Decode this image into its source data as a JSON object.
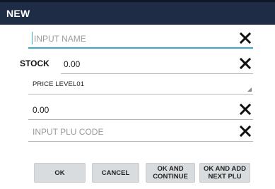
{
  "dialog": {
    "title": "NEW"
  },
  "fields": {
    "name": {
      "placeholder": "INPUT NAME",
      "value": ""
    },
    "stock": {
      "label": "STOCK",
      "value": "0.00"
    },
    "price_level": {
      "selected": "PRICE LEVEL01"
    },
    "price": {
      "value": "0.00"
    },
    "plu": {
      "placeholder": "INPUT PLU CODE",
      "value": ""
    }
  },
  "buttons": {
    "ok": "OK",
    "cancel": "CANCEL",
    "ok_continue": [
      "OK AND",
      "CONTINUE"
    ],
    "ok_add_next": [
      "OK AND ADD",
      "NEXT PLU"
    ]
  },
  "icons": {
    "clear": "close-icon",
    "dropdown": "dropdown-triangle-icon"
  },
  "colors": {
    "titlebar": "#1e2c45",
    "accent": "#3aa8cf",
    "button_bg": "#d9dcde"
  }
}
